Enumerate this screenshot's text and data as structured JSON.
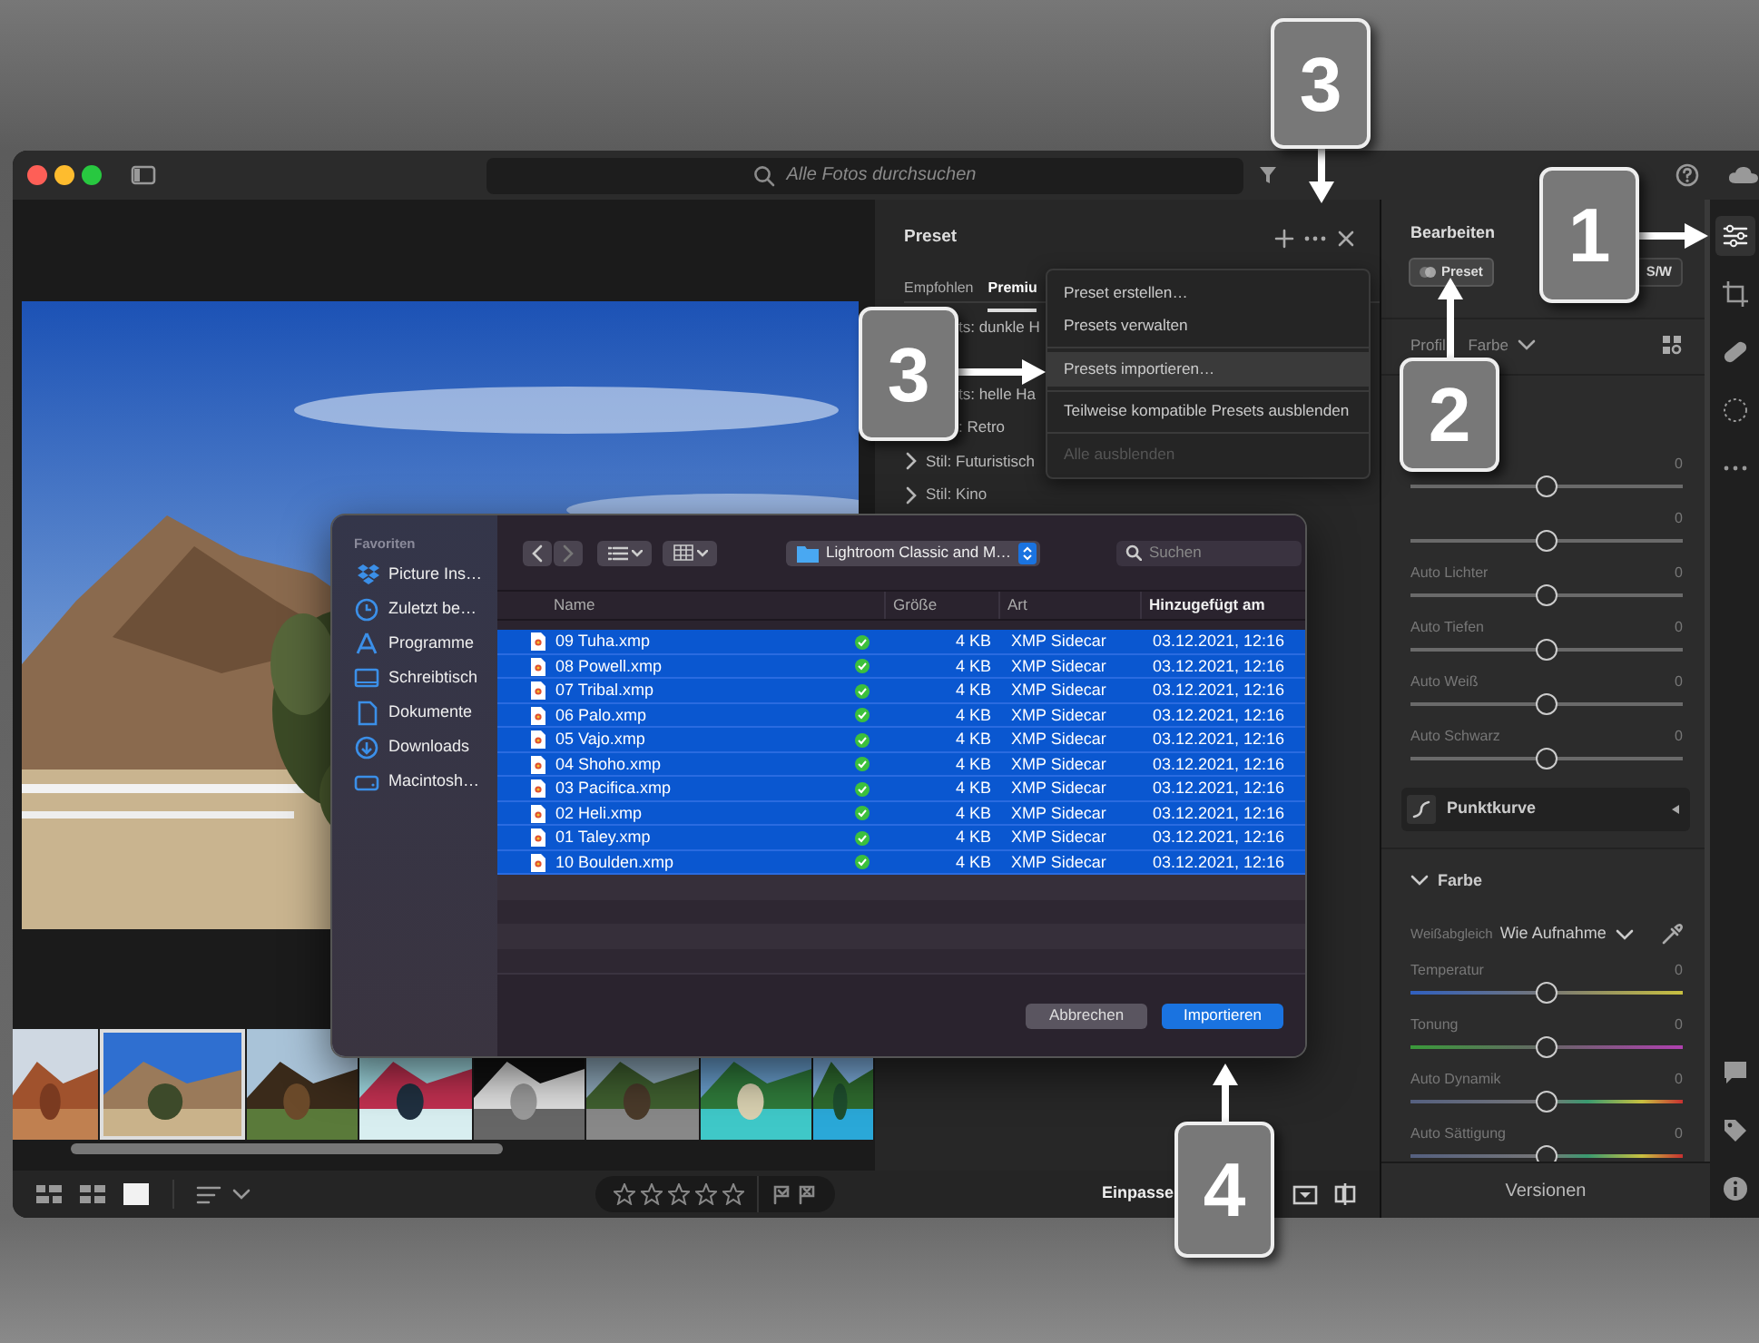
{
  "titlebar": {
    "search_placeholder": "Alle Fotos durchsuchen"
  },
  "photo": {
    "kind": "picture"
  },
  "filmstrip": [
    {
      "kind": "picture",
      "selected": false
    },
    {
      "kind": "picture",
      "selected": true
    },
    {
      "kind": "picture",
      "selected": false
    },
    {
      "kind": "picture",
      "selected": false
    },
    {
      "kind": "picture",
      "selected": false
    },
    {
      "kind": "picture",
      "selected": false
    },
    {
      "kind": "picture",
      "selected": false
    },
    {
      "kind": "picture",
      "selected": false
    }
  ],
  "bottom_toolbar": {
    "view_modes": [
      {
        "kind": "grid-large",
        "selected": false
      },
      {
        "kind": "grid-small",
        "selected": false
      },
      {
        "kind": "single",
        "selected": true
      }
    ],
    "stars": 0,
    "zoom": "Einpasse"
  },
  "preset_panel": {
    "title": "Preset",
    "tabs": [
      {
        "label": "Empfohlen",
        "selected": false
      },
      {
        "label": "Premiu",
        "selected": true
      }
    ],
    "groups": [
      {
        "label": "ts: dunkle H",
        "kind": "fragment"
      },
      {
        "kind": "covered"
      },
      {
        "label": "ts: helle Ha",
        "kind": "fragment"
      },
      {
        "label": ": Retro",
        "kind": "fragment"
      },
      {
        "label": "Stil: Futuristisch",
        "kind": "group"
      },
      {
        "label": "Stil: Kino",
        "kind": "group"
      }
    ]
  },
  "preset_menu": [
    {
      "kind": "item",
      "label": "Preset erstellen…",
      "highlighted": false,
      "disabled": false
    },
    {
      "kind": "item",
      "label": "Presets verwalten",
      "highlighted": false,
      "disabled": false
    },
    {
      "kind": "separator"
    },
    {
      "kind": "item",
      "label": "Presets importieren…",
      "highlighted": true,
      "disabled": false
    },
    {
      "kind": "separator"
    },
    {
      "kind": "item",
      "label": "Teilweise kompatible Presets ausblenden",
      "highlighted": false,
      "disabled": false
    },
    {
      "kind": "separator"
    },
    {
      "kind": "item",
      "label": "Alle ausblenden",
      "highlighted": false,
      "disabled": true
    }
  ],
  "edit_panel": {
    "title": "Bearbeiten",
    "buttons": [
      {
        "label": "Preset",
        "selected": true
      },
      {
        "label": "S/W",
        "selected": false
      }
    ],
    "profile": "Profil Farbe",
    "sliders": [
      {
        "value": "0",
        "level": 0.5,
        "kind": "gray"
      },
      {
        "value": "0",
        "level": 0.5,
        "kind": "gray"
      },
      {
        "label": "Auto Lichter",
        "value": "0",
        "level": 0.5,
        "kind": "gray"
      },
      {
        "label": "Auto Tiefen",
        "value": "0",
        "level": 0.5,
        "kind": "gray"
      },
      {
        "label": "Auto Weiß",
        "value": "0",
        "level": 0.5,
        "kind": "gray"
      },
      {
        "label": "Auto Schwarz",
        "value": "0",
        "level": 0.5,
        "kind": "gray"
      }
    ],
    "curve": {
      "label": "Punktkurve",
      "expanded": false
    },
    "color_section": {
      "label": "Farbe",
      "expanded": true
    },
    "white_balance": {
      "label": "Weißabgleich",
      "value": "Wie Aufnahme"
    },
    "color_sliders": [
      {
        "label": "Temperatur",
        "value": "0",
        "level": 0.5,
        "kind": "temperature"
      },
      {
        "label": "Tonung",
        "value": "0",
        "level": 0.5,
        "kind": "tint"
      },
      {
        "label": "Auto Dynamik",
        "value": "0",
        "level": 0.5,
        "kind": "saturation"
      },
      {
        "label": "Auto Sättigung",
        "value": "0",
        "level": 0.5,
        "kind": "saturation"
      }
    ],
    "footer": "Versionen"
  },
  "tool_strip": [
    {
      "kind": "adjust",
      "selected": true
    },
    {
      "kind": "crop",
      "selected": false
    },
    {
      "kind": "heal",
      "selected": false
    },
    {
      "kind": "mask",
      "selected": false
    },
    {
      "kind": "more",
      "selected": false
    }
  ],
  "info_strip": [
    {
      "kind": "comment"
    },
    {
      "kind": "tag"
    },
    {
      "kind": "info"
    }
  ],
  "dialog": {
    "section": "Favoriten",
    "places": [
      {
        "label": "Picture Ins…",
        "kind": "dropbox",
        "selected": false
      },
      {
        "label": "Zuletzt be…",
        "kind": "recent",
        "selected": false
      },
      {
        "label": "Programme",
        "kind": "apps",
        "selected": false
      },
      {
        "label": "Schreibtisch",
        "kind": "desktop",
        "selected": false
      },
      {
        "label": "Dokumente",
        "kind": "document",
        "selected": false
      },
      {
        "label": "Downloads",
        "kind": "download",
        "selected": false
      },
      {
        "label": "Macintosh…",
        "kind": "disk",
        "selected": false
      }
    ],
    "folder": "Lightroom Classic and M…",
    "search_placeholder": "Suchen",
    "columns": [
      {
        "label": "Name",
        "sorted": false
      },
      {
        "label": "Größe",
        "sorted": false
      },
      {
        "label": "Art",
        "sorted": false
      },
      {
        "label": "Hinzugefügt am",
        "sorted": true
      }
    ],
    "rows": [
      {
        "name": "09 Tuha.xmp",
        "size": "4 KB",
        "type": "XMP Sidecar",
        "added": "03.12.2021, 12:16",
        "selected": true
      },
      {
        "name": "08 Powell.xmp",
        "size": "4 KB",
        "type": "XMP Sidecar",
        "added": "03.12.2021, 12:16",
        "selected": true
      },
      {
        "name": "07 Tribal.xmp",
        "size": "4 KB",
        "type": "XMP Sidecar",
        "added": "03.12.2021, 12:16",
        "selected": true
      },
      {
        "name": "06 Palo.xmp",
        "size": "4 KB",
        "type": "XMP Sidecar",
        "added": "03.12.2021, 12:16",
        "selected": true
      },
      {
        "name": "05 Vajo.xmp",
        "size": "4 KB",
        "type": "XMP Sidecar",
        "added": "03.12.2021, 12:16",
        "selected": true
      },
      {
        "name": "04 Shoho.xmp",
        "size": "4 KB",
        "type": "XMP Sidecar",
        "added": "03.12.2021, 12:16",
        "selected": true
      },
      {
        "name": "03 Pacifica.xmp",
        "size": "4 KB",
        "type": "XMP Sidecar",
        "added": "03.12.2021, 12:16",
        "selected": true
      },
      {
        "name": "02 Heli.xmp",
        "size": "4 KB",
        "type": "XMP Sidecar",
        "added": "03.12.2021, 12:16",
        "selected": true
      },
      {
        "name": "01 Taley.xmp",
        "size": "4 KB",
        "type": "XMP Sidecar",
        "added": "03.12.2021, 12:16",
        "selected": true
      },
      {
        "name": "10 Boulden.xmp",
        "size": "4 KB",
        "type": "XMP Sidecar",
        "added": "03.12.2021, 12:16",
        "selected": true
      }
    ],
    "buttons": [
      {
        "label": "Abbrechen",
        "kind": "cancel"
      },
      {
        "label": "Importieren",
        "kind": "default"
      }
    ]
  },
  "callouts": [
    {
      "label": "3",
      "kind": "down"
    },
    {
      "label": "1",
      "kind": "right"
    },
    {
      "label": "3",
      "kind": "right"
    },
    {
      "label": "2",
      "kind": "up"
    },
    {
      "label": "4",
      "kind": "up"
    }
  ]
}
